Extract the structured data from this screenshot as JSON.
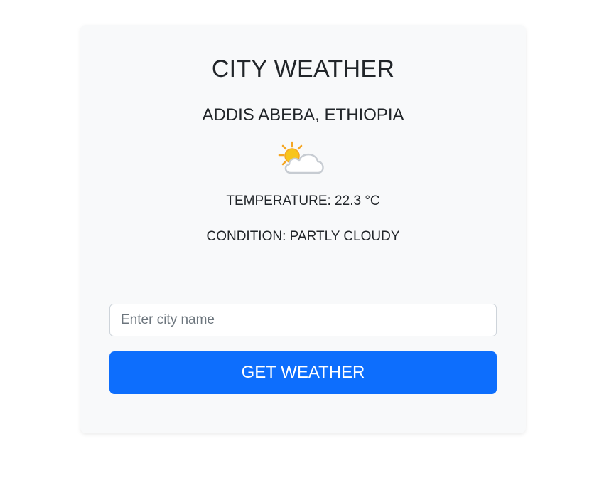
{
  "card": {
    "title": "CITY WEATHER",
    "location": "ADDIS ABEBA, ETHIOPIA",
    "weather_icon": "partly-cloudy-icon",
    "temperature_text": "TEMPERATURE: 22.3 °C",
    "condition_text": "CONDITION: PARTLY CLOUDY"
  },
  "search": {
    "value": "",
    "placeholder": "Enter city name"
  },
  "actions": {
    "get_weather_label": "GET WEATHER"
  },
  "colors": {
    "card_background": "#f8f9fa",
    "button_primary": "#0d6efd",
    "text": "#212529",
    "input_border": "#ced4da"
  }
}
